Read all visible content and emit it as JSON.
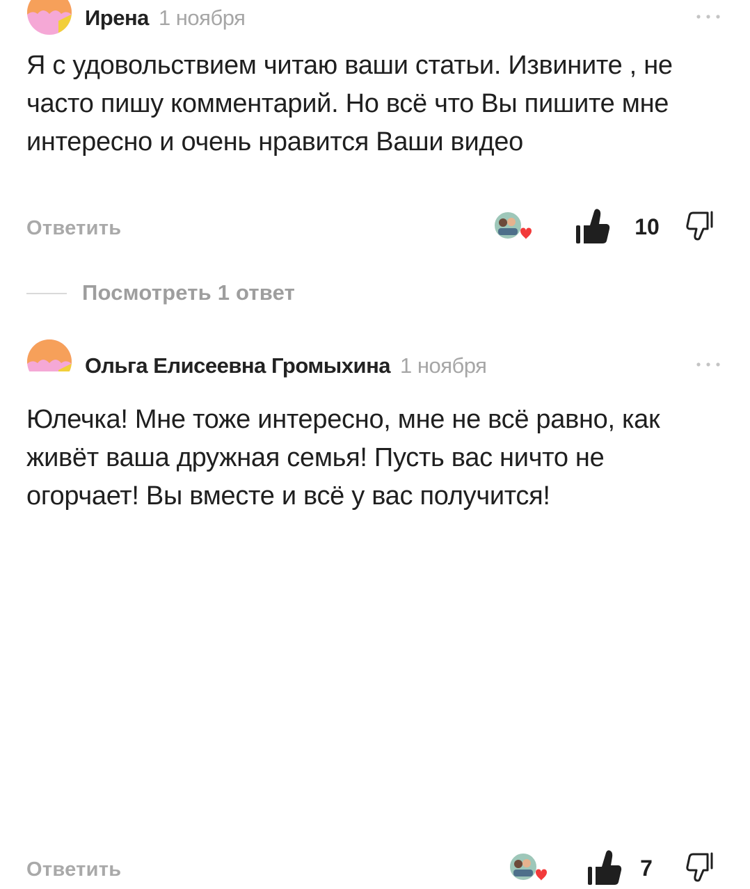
{
  "comments": [
    {
      "author": "Ирена",
      "date": "1 ноября",
      "text": "Я с удовольствием читаю ваши статьи. Извините , не часто пишу комментарий. Но всё что Вы пишите мне интересно и очень нравится Ваши видео",
      "reply_label": "Ответить",
      "likes": "10",
      "avatar_icon": "user-avatar-icon",
      "more_icon": "more-dots-icon"
    },
    {
      "author": "Ольга Елисеевна Громыхина",
      "date": "1 ноября",
      "text": "Юлечка! Мне тоже интересно, мне не всё равно, как живёт ваша дружная семья! Пусть вас ничто не огорчает! Вы вместе и всё у вас получится!",
      "reply_label": "Ответить",
      "likes": "7",
      "avatar_icon": "user-avatar-icon",
      "more_icon": "more-dots-icon"
    }
  ],
  "thread": {
    "view_replies_label": "Посмотреть 1 ответ"
  },
  "colors": {
    "avatar_orange": "#f6a05a",
    "avatar_pink": "#f5a8d6",
    "avatar_yellow": "#f2cf3a",
    "heart_red": "#f23a3a",
    "muted_text": "#a9a9a9"
  }
}
